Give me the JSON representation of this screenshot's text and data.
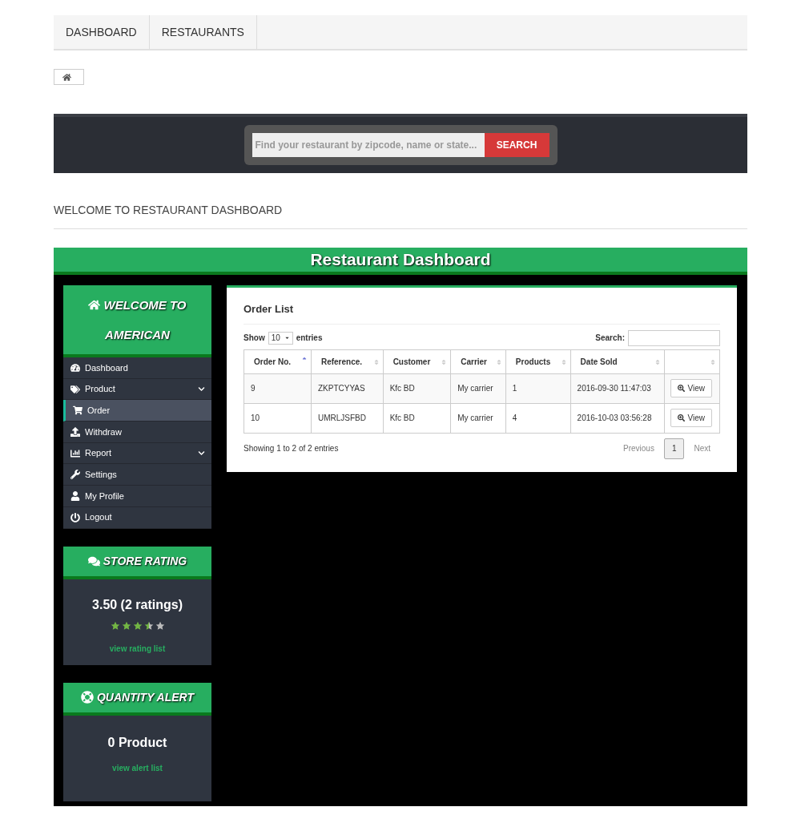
{
  "top_nav": [
    "DASHBOARD",
    "RESTAURANTS"
  ],
  "search_band": {
    "placeholder": "Find your restaurant by zipcode, name or state...",
    "button": "SEARCH"
  },
  "page_heading": "WELCOME TO RESTAURANT DASHBOARD",
  "dashboard": {
    "title": "Restaurant Dashboard",
    "sidebar": {
      "welcome": [
        "WELCOME TO",
        "AMERICAN"
      ],
      "items": [
        {
          "label": "Dashboard",
          "selected": false,
          "submenu": false
        },
        {
          "label": "Product",
          "selected": false,
          "submenu": true
        },
        {
          "label": "Order",
          "selected": true,
          "submenu": false
        },
        {
          "label": "Withdraw",
          "selected": false,
          "submenu": false
        },
        {
          "label": "Report",
          "selected": false,
          "submenu": true
        },
        {
          "label": "Settings",
          "selected": false,
          "submenu": false
        },
        {
          "label": "My Profile",
          "selected": false,
          "submenu": false
        },
        {
          "label": "Logout",
          "selected": false,
          "submenu": false
        }
      ]
    },
    "store_rating": {
      "title": "STORE RATING",
      "value": "3.50 (2 ratings)",
      "stars": 3.5,
      "link": "view rating list"
    },
    "quantity_alert": {
      "title": "QUANTITY ALERT",
      "value": "0 Product",
      "link": "view alert list"
    },
    "order_list": {
      "title": "Order List",
      "show_label": "Show",
      "page_size": "10",
      "entries_label": "entries",
      "search_label": "Search:",
      "columns": [
        {
          "label": "Order No.",
          "sorted": true
        },
        {
          "label": "Reference.",
          "sorted": false
        },
        {
          "label": "Customer",
          "sorted": false
        },
        {
          "label": "Carrier",
          "sorted": false
        },
        {
          "label": "Products",
          "sorted": false
        },
        {
          "label": "Date Sold",
          "sorted": false
        },
        {
          "sorted": false
        }
      ],
      "rows": [
        {
          "cells": [
            "9",
            "ZKPTCYYAS",
            "Kfc BD",
            "My carrier",
            "1",
            "2016-09-30 11:47:03"
          ],
          "action": "View"
        },
        {
          "cells": [
            "10",
            "UMRLJSFBD",
            "Kfc BD",
            "My carrier",
            "4",
            "2016-10-03 03:56:28"
          ],
          "action": "View"
        }
      ],
      "info": "Showing 1 to 2 of 2 entries",
      "pagination": [
        {
          "label": "Previous",
          "kind": "prev",
          "selected": false
        },
        {
          "label": "1",
          "kind": "page",
          "selected": true
        },
        {
          "label": "Next",
          "kind": "next",
          "selected": false
        }
      ]
    }
  }
}
